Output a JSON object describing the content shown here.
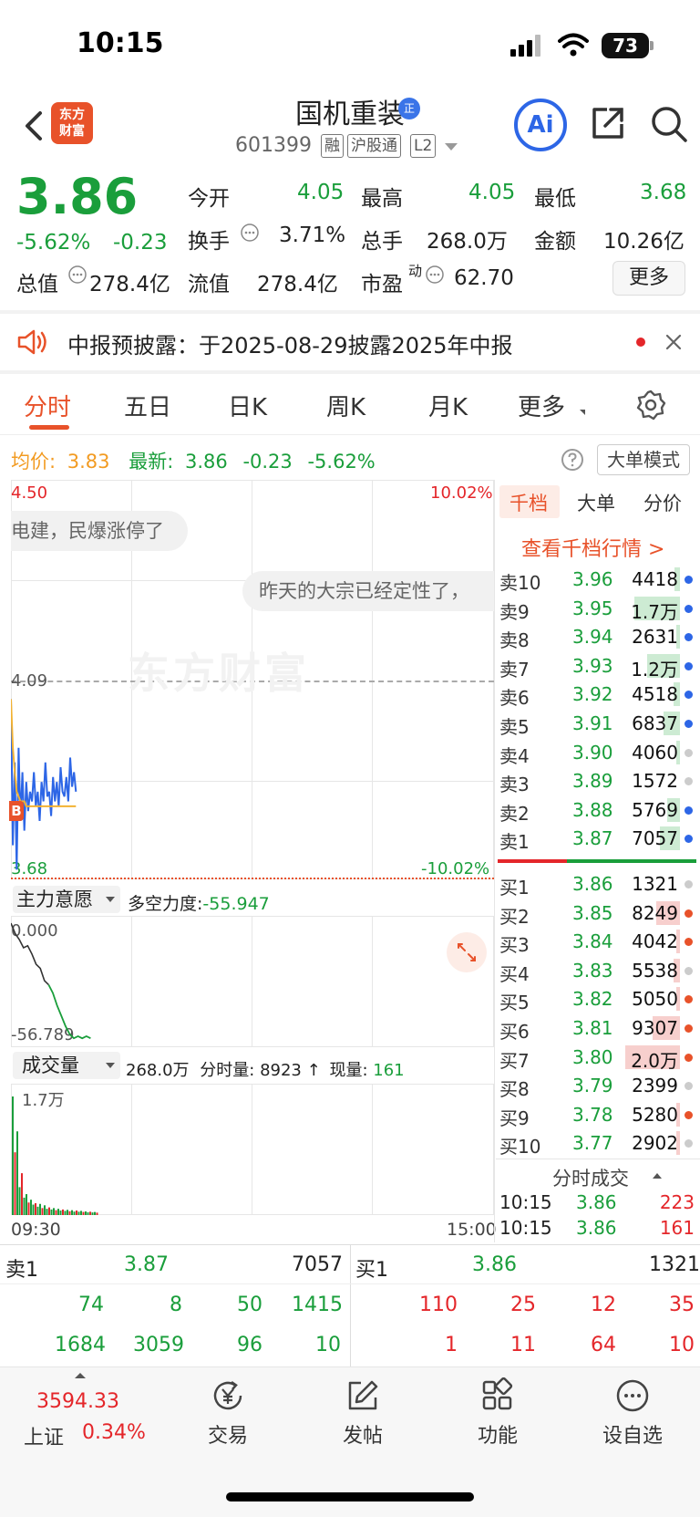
{
  "status": {
    "time": "10:15",
    "battery": "73"
  },
  "header": {
    "logo": [
      "东方",
      "财富"
    ],
    "stock_name": "国机重装",
    "name_badge": "正",
    "stock_code": "601399",
    "tags": [
      "融",
      "沪股通",
      "L2"
    ],
    "ai_label": "Ai"
  },
  "quote": {
    "price": "3.86",
    "change_pct": "-5.62%",
    "change_amt": "-0.23",
    "stats": [
      {
        "label": "今开",
        "value": "4.05",
        "color": "green"
      },
      {
        "label": "最高",
        "value": "4.05",
        "color": "green"
      },
      {
        "label": "最低",
        "value": "3.68",
        "color": "green"
      },
      {
        "label": "换手",
        "value": "3.71%",
        "color": "black"
      },
      {
        "label": "总手",
        "value": "268.0万",
        "color": "black"
      },
      {
        "label": "金额",
        "value": "10.26亿",
        "color": "black"
      },
      {
        "label": "总值",
        "value": "278.4亿",
        "color": "black"
      },
      {
        "label": "流值",
        "value": "278.4亿",
        "color": "black"
      },
      {
        "label": "市盈",
        "value": "62.70",
        "color": "black"
      }
    ],
    "pe_superscript": "动",
    "more_label": "更多"
  },
  "notice": {
    "text": "中报预披露：于2025-08-29披露2025年中报"
  },
  "tabs": [
    "分时",
    "五日",
    "日K",
    "周K",
    "月K",
    "更多"
  ],
  "price_line": {
    "avg_label": "均价:",
    "avg_value": "3.83",
    "latest_label": "最新:",
    "latest_value": "3.86",
    "change_amt": "-0.23",
    "change_pct": "-5.62%",
    "bigmode_label": "大单模式"
  },
  "intraday_chart": {
    "y_top": "4.50",
    "y_top_pct": "10.02%",
    "y_mid": "4.09",
    "y_bottom": "3.68",
    "y_bottom_pct": "-10.02%",
    "watermark": "东方财富",
    "bubble1": "电建，民爆涨停了",
    "bubble2": "昨天的大宗已经定性了，",
    "b_marker": "B"
  },
  "chart_data": [
    {
      "type": "line",
      "title": "",
      "series": [
        {
          "name": "最新",
          "values": [
            4.05,
            3.75,
            3.92,
            3.7,
            3.95,
            3.8,
            3.9,
            3.78,
            3.88,
            3.82,
            3.86,
            3.84,
            3.9,
            3.83,
            3.86,
            3.8,
            3.88,
            3.84,
            3.92,
            3.85,
            3.86,
            3.81,
            3.89,
            3.84,
            3.88,
            3.83,
            3.91,
            3.86,
            3.85,
            3.89,
            3.84,
            3.93,
            3.87,
            3.9,
            3.86
          ]
        },
        {
          "name": "均价",
          "values": [
            4.05,
            3.95,
            3.9,
            3.86,
            3.85,
            3.84,
            3.84,
            3.84,
            3.83,
            3.83,
            3.83,
            3.83,
            3.83,
            3.83,
            3.83,
            3.83,
            3.83,
            3.83,
            3.83,
            3.83,
            3.83,
            3.83,
            3.83,
            3.83,
            3.83,
            3.83,
            3.83,
            3.83,
            3.83,
            3.83,
            3.83,
            3.83,
            3.83,
            3.83,
            3.83
          ]
        }
      ],
      "ylim": [
        3.68,
        4.5
      ],
      "prev_close": 4.09,
      "x_start": "09:30",
      "x_end": "15:00"
    },
    {
      "type": "line",
      "series": [
        {
          "name": "多空力度",
          "values": [
            0.0,
            -5,
            -8,
            -12,
            -11,
            -15,
            -20,
            -22,
            -28,
            -30,
            -34,
            -40,
            -45,
            -50,
            -54,
            -56,
            -55,
            -56,
            -55,
            -56
          ]
        }
      ],
      "ylim": [
        -56.789,
        0.0
      ]
    },
    {
      "type": "bar",
      "series": [
        {
          "name": "成交量",
          "values": [
            17000,
            9000,
            12000,
            4000,
            6000,
            2500,
            3000,
            1800,
            2200,
            1500,
            1700,
            1200,
            1600,
            1000,
            1400,
            900,
            1100,
            800,
            1000,
            700,
            900,
            650,
            800,
            600,
            750,
            550,
            700,
            500,
            650,
            480,
            600,
            450,
            520,
            400,
            480,
            380,
            440,
            350
          ]
        }
      ],
      "ylim": [
        0,
        17000
      ]
    }
  ],
  "indicator": {
    "dropdown_label": "主力意愿",
    "desc_label": "多空力度:",
    "desc_value": "-55.947",
    "y_top": "0.000",
    "y_bottom": "-56.789"
  },
  "volume": {
    "dropdown_label": "成交量",
    "total": "268.0万",
    "fen_label": "分时量:",
    "fen_value": "8923",
    "now_label": "现量:",
    "now_value": "161",
    "y_top": "1.7万",
    "x_start": "09:30",
    "x_end": "15:00"
  },
  "orderbook": {
    "tabs": [
      "千档",
      "大单",
      "分价"
    ],
    "link": "查看千档行情 >",
    "asks": [
      {
        "label": "卖10",
        "price": "3.96",
        "vol": "4418",
        "dot": "#2d66e6",
        "bar": 0.08
      },
      {
        "label": "卖9",
        "price": "3.95",
        "vol": "1.7万",
        "dot": "#2d66e6",
        "bar": 0.62
      },
      {
        "label": "卖8",
        "price": "3.94",
        "vol": "2631",
        "dot": "#2d66e6",
        "bar": 0.05
      },
      {
        "label": "卖7",
        "price": "3.93",
        "vol": "1.2万",
        "dot": "#2d66e6",
        "bar": 0.45
      },
      {
        "label": "卖6",
        "price": "3.92",
        "vol": "4518",
        "dot": "#2d66e6",
        "bar": 0.09
      },
      {
        "label": "卖5",
        "price": "3.91",
        "vol": "6837",
        "dot": "#2d66e6",
        "bar": 0.22
      },
      {
        "label": "卖4",
        "price": "3.90",
        "vol": "4060",
        "dot": "#cccccc",
        "bar": 0.05
      },
      {
        "label": "卖3",
        "price": "3.89",
        "vol": "1572",
        "dot": "#cccccc",
        "bar": 0
      },
      {
        "label": "卖2",
        "price": "3.88",
        "vol": "5769",
        "dot": "#2d66e6",
        "bar": 0.18
      },
      {
        "label": "卖1",
        "price": "3.87",
        "vol": "7057",
        "dot": "#2d66e6",
        "bar": 0.28
      }
    ],
    "bids": [
      {
        "label": "买1",
        "price": "3.86",
        "vol": "1321",
        "dot": "#cccccc",
        "bar": 0
      },
      {
        "label": "买2",
        "price": "3.85",
        "vol": "8249",
        "dot": "#e8522a",
        "bar": 0.33
      },
      {
        "label": "买3",
        "price": "3.84",
        "vol": "4042",
        "dot": "#e8522a",
        "bar": 0.05
      },
      {
        "label": "买4",
        "price": "3.83",
        "vol": "5538",
        "dot": "#cccccc",
        "bar": 0.09
      },
      {
        "label": "买5",
        "price": "3.82",
        "vol": "5050",
        "dot": "#e8522a",
        "bar": 0.05
      },
      {
        "label": "买6",
        "price": "3.81",
        "vol": "9307",
        "dot": "#e8522a",
        "bar": 0.38
      },
      {
        "label": "买7",
        "price": "3.80",
        "vol": "2.0万",
        "dot": "#e8522a",
        "bar": 0.75
      },
      {
        "label": "买8",
        "price": "3.79",
        "vol": "2399",
        "dot": "#cccccc",
        "bar": 0
      },
      {
        "label": "买9",
        "price": "3.78",
        "vol": "5280",
        "dot": "#e8522a",
        "bar": 0.05
      },
      {
        "label": "买10",
        "price": "3.77",
        "vol": "2902",
        "dot": "#cccccc",
        "bar": 0.05
      }
    ],
    "trades_label": "分时成交",
    "trades": [
      {
        "time": "10:15",
        "price": "3.86",
        "vol": "223"
      },
      {
        "time": "10:15",
        "price": "3.86",
        "vol": "161"
      }
    ]
  },
  "bottom_quote": {
    "sell_label": "卖1",
    "sell_price": "3.87",
    "sell_vol": "7057",
    "buy_label": "买1",
    "buy_price": "3.86",
    "buy_vol": "1321",
    "sell_rows": [
      [
        "74",
        "8",
        "50",
        "1415"
      ],
      [
        "1684",
        "3059",
        "96",
        "10"
      ]
    ],
    "buy_rows": [
      [
        "110",
        "25",
        "12",
        "35"
      ],
      [
        "1",
        "11",
        "64",
        "10"
      ]
    ]
  },
  "tabbar": {
    "index_value": "3594.33",
    "index_name": "上证",
    "index_pct": "0.34%",
    "items": [
      "交易",
      "发帖",
      "功能",
      "设自选"
    ]
  }
}
